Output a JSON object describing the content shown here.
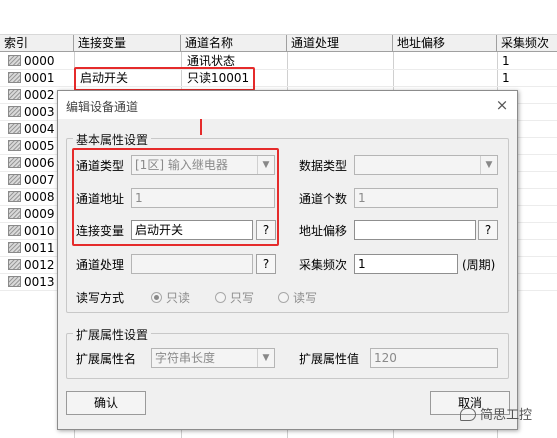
{
  "table": {
    "columns": [
      "索引",
      "连接变量",
      "通道名称",
      "通道处理",
      "地址偏移",
      "采集频次"
    ],
    "rows": [
      {
        "index": "0000",
        "variable": "",
        "name": "通讯状态",
        "freq": "1"
      },
      {
        "index": "0001",
        "variable": "启动开关",
        "name": "只读10001",
        "freq": "1"
      },
      {
        "index": "0002",
        "variable": "",
        "name": "",
        "freq": ""
      },
      {
        "index": "0003",
        "variable": "",
        "name": "",
        "freq": ""
      },
      {
        "index": "0004",
        "variable": "",
        "name": "",
        "freq": ""
      },
      {
        "index": "0005",
        "variable": "",
        "name": "",
        "freq": ""
      },
      {
        "index": "0006",
        "variable": "",
        "name": "",
        "freq": ""
      },
      {
        "index": "0007",
        "variable": "",
        "name": "",
        "freq": ""
      },
      {
        "index": "0008",
        "variable": "",
        "name": "",
        "freq": ""
      },
      {
        "index": "0009",
        "variable": "",
        "name": "",
        "freq": ""
      },
      {
        "index": "0010",
        "variable": "",
        "name": "",
        "freq": ""
      },
      {
        "index": "0011",
        "variable": "",
        "name": "",
        "freq": ""
      },
      {
        "index": "0012",
        "variable": "",
        "name": "",
        "freq": ""
      },
      {
        "index": "0013",
        "variable": "",
        "name": "",
        "freq": ""
      }
    ]
  },
  "dialog": {
    "title": "编辑设备通道",
    "basic_group": "基本属性设置",
    "channel_type_label": "通道类型",
    "channel_type_value": "[1区] 输入继电器",
    "data_type_label": "数据类型",
    "data_type_value": "",
    "channel_addr_label": "通道地址",
    "channel_addr_value": "1",
    "channel_count_label": "通道个数",
    "channel_count_value": "1",
    "link_var_label": "连接变量",
    "link_var_value": "启动开关",
    "addr_offset_label": "地址偏移",
    "addr_offset_value": "",
    "channel_proc_label": "通道处理",
    "channel_proc_value": "",
    "freq_label": "采集频次",
    "freq_value": "1",
    "freq_unit": "(周期)",
    "rw_label": "读写方式",
    "rw_options": [
      "只读",
      "只写",
      "读写"
    ],
    "rw_selected": "只读",
    "ext_group": "扩展属性设置",
    "ext_name_label": "扩展属性名",
    "ext_name_value": "字符串长度",
    "ext_value_label": "扩展属性值",
    "ext_value_value": "120",
    "question": "?",
    "close": "×",
    "ok_button": "确认",
    "cancel_button": "取消"
  },
  "watermark": "简思工控",
  "annotation_color": "#e52b2b"
}
